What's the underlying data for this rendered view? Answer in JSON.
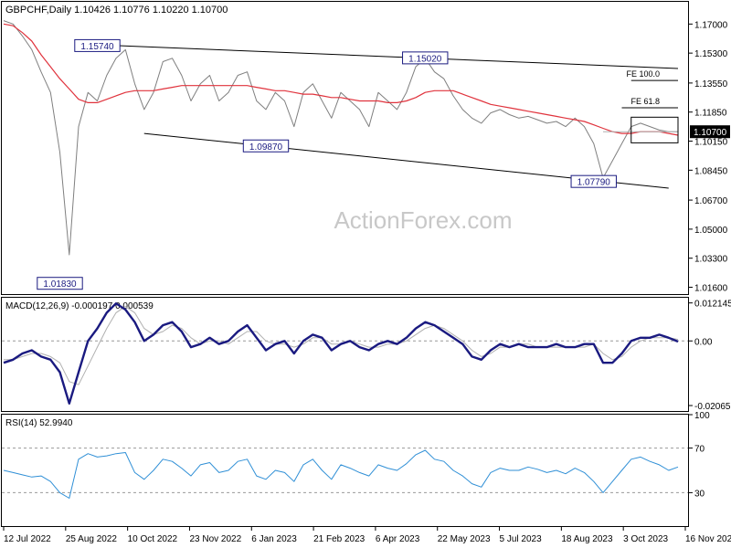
{
  "chart_data": [
    {
      "type": "line",
      "panel": "price",
      "header": "GBPCHF,Daily  1.10426 1.10776 1.10220 1.10700",
      "watermark": "ActionForex.com",
      "ylim": [
        1.012,
        1.183
      ],
      "y_ticks": [
        "1.17000",
        "1.15300",
        "1.13550",
        "1.11850",
        "1.10150",
        "1.08450",
        "1.06700",
        "1.05000",
        "1.03300",
        "1.01600"
      ],
      "current_price": "1.10700",
      "x_dates": [
        "2022-07-12",
        "2022-07-19",
        "2022-07-26",
        "2022-08-02",
        "2022-08-09",
        "2022-08-16",
        "2022-08-23",
        "2022-08-30",
        "2022-09-06",
        "2022-09-13",
        "2022-09-20",
        "2022-09-27",
        "2022-10-04",
        "2022-10-11",
        "2022-10-18",
        "2022-10-25",
        "2022-11-01",
        "2022-11-08",
        "2022-11-15",
        "2022-11-22",
        "2022-11-29",
        "2022-12-06",
        "2022-12-13",
        "2022-12-20",
        "2022-12-27",
        "2023-01-03",
        "2023-01-10",
        "2023-01-17",
        "2023-01-24",
        "2023-01-31",
        "2023-02-07",
        "2023-02-14",
        "2023-02-21",
        "2023-02-28",
        "2023-03-07",
        "2023-03-14",
        "2023-03-21",
        "2023-03-28",
        "2023-04-04",
        "2023-04-11",
        "2023-04-18",
        "2023-04-25",
        "2023-05-02",
        "2023-05-09",
        "2023-05-16",
        "2023-05-23",
        "2023-05-30",
        "2023-06-06",
        "2023-06-13",
        "2023-06-20",
        "2023-06-27",
        "2023-07-04",
        "2023-07-11",
        "2023-07-18",
        "2023-07-25",
        "2023-08-01",
        "2023-08-08",
        "2023-08-15",
        "2023-08-22",
        "2023-08-29",
        "2023-09-05",
        "2023-09-12",
        "2023-09-19",
        "2023-09-26",
        "2023-10-03",
        "2023-10-10",
        "2023-10-17",
        "2023-10-24",
        "2023-10-31",
        "2023-11-07",
        "2023-11-14",
        "2023-11-21",
        "2023-11-28"
      ],
      "series": [
        {
          "name": "",
          "color": "#7f7f7f",
          "values": [
            1.172,
            1.17,
            1.163,
            1.155,
            1.142,
            1.13,
            1.095,
            1.035,
            1.11,
            1.13,
            1.125,
            1.14,
            1.15,
            1.155,
            1.135,
            1.12,
            1.13,
            1.148,
            1.15,
            1.14,
            1.125,
            1.135,
            1.14,
            1.125,
            1.13,
            1.14,
            1.142,
            1.125,
            1.12,
            1.13,
            1.125,
            1.11,
            1.13,
            1.135,
            1.125,
            1.115,
            1.13,
            1.125,
            1.12,
            1.11,
            1.13,
            1.125,
            1.12,
            1.13,
            1.145,
            1.15,
            1.142,
            1.138,
            1.128,
            1.12,
            1.115,
            1.112,
            1.118,
            1.12,
            1.117,
            1.115,
            1.116,
            1.114,
            1.112,
            1.113,
            1.11,
            1.115,
            1.11,
            1.1,
            1.08,
            1.09,
            1.1,
            1.11,
            1.112,
            1.11,
            1.108,
            1.107,
            1.107
          ]
        },
        {
          "name": "",
          "color": "#e0333d",
          "values": [
            1.17,
            1.169,
            1.165,
            1.16,
            1.152,
            1.145,
            1.138,
            1.132,
            1.126,
            1.124,
            1.124,
            1.126,
            1.128,
            1.13,
            1.131,
            1.131,
            1.131,
            1.132,
            1.133,
            1.134,
            1.134,
            1.134,
            1.134,
            1.134,
            1.134,
            1.134,
            1.134,
            1.133,
            1.132,
            1.131,
            1.131,
            1.13,
            1.129,
            1.129,
            1.128,
            1.127,
            1.127,
            1.126,
            1.125,
            1.125,
            1.125,
            1.124,
            1.124,
            1.125,
            1.127,
            1.13,
            1.131,
            1.131,
            1.131,
            1.129,
            1.127,
            1.125,
            1.123,
            1.122,
            1.121,
            1.12,
            1.119,
            1.118,
            1.117,
            1.116,
            1.115,
            1.114,
            1.113,
            1.111,
            1.109,
            1.107,
            1.106,
            1.106,
            1.107,
            1.107,
            1.107,
            1.106,
            1.105
          ]
        }
      ],
      "trendlines": [
        {
          "from": [
            "2022-10-04",
            1.1574
          ],
          "to": [
            "2023-11-28",
            1.144
          ],
          "color": "#000000"
        },
        {
          "from": [
            "2022-10-25",
            1.106
          ],
          "to": [
            "2023-11-21",
            1.074
          ],
          "color": "#000000"
        },
        {
          "from": [
            "2023-10-03",
            1.107
          ],
          "to": [
            "2023-11-28",
            1.107
          ],
          "color": "#b0b0b0"
        }
      ],
      "levels": [
        {
          "label": "FE 100.0",
          "y": 1.137,
          "from": "2023-10-24",
          "to": "2023-11-28",
          "color": "#000000"
        },
        {
          "label": "FE 61.8",
          "y": 1.121,
          "from": "2023-10-17",
          "to": "2023-11-28",
          "color": "#000000"
        }
      ],
      "box": {
        "from": "2023-10-24",
        "to": "2023-11-28",
        "y_top": 1.1155,
        "y_bottom": 1.1005
      },
      "annotations": [
        {
          "label": "1.15740",
          "x": "2022-09-20",
          "y": 1.1574
        },
        {
          "label": "1.15020",
          "x": "2023-05-23",
          "y": 1.1502
        },
        {
          "label": "1.09870",
          "x": "2023-01-24",
          "y": 1.0987
        },
        {
          "label": "1.07790",
          "x": "2023-09-26",
          "y": 1.0779
        },
        {
          "label": "1.01830",
          "x": "2022-08-23",
          "y": 1.0183
        }
      ],
      "x_labels": [
        "12 Jul 2022",
        "25 Aug 2022",
        "10 Oct 2022",
        "23 Nov 2022",
        "6 Jan 2023",
        "21 Feb 2023",
        "6 Apr 2023",
        "22 May 2023",
        "5 Jul 2023",
        "18 Aug 2023",
        "3 Oct 2023",
        "16 Nov 2023"
      ]
    },
    {
      "type": "line",
      "panel": "macd",
      "header": "MACD(12,26,9) -0.000197 0.000539",
      "ylim": [
        -0.0224,
        0.0138
      ],
      "y_ticks": [
        "0.012145",
        "0.00",
        "-0.020656"
      ],
      "zero_line": 0,
      "series": [
        {
          "name": "",
          "color": "#1a1a80",
          "values": [
            -0.007,
            -0.006,
            -0.004,
            -0.003,
            -0.005,
            -0.006,
            -0.01,
            -0.02,
            -0.01,
            0.0,
            0.004,
            0.009,
            0.012,
            0.01,
            0.006,
            0.0,
            0.002,
            0.005,
            0.006,
            0.003,
            -0.002,
            -0.001,
            0.001,
            -0.001,
            0.0,
            0.003,
            0.005,
            0.001,
            -0.003,
            -0.001,
            0.0,
            -0.004,
            0.0,
            0.002,
            0.001,
            -0.003,
            -0.001,
            0.0,
            -0.002,
            -0.003,
            -0.001,
            0.0,
            -0.001,
            0.001,
            0.004,
            0.006,
            0.005,
            0.003,
            0.001,
            -0.001,
            -0.005,
            -0.006,
            -0.003,
            -0.001,
            -0.002,
            -0.001,
            -0.002,
            -0.002,
            -0.002,
            -0.001,
            -0.002,
            -0.002,
            -0.001,
            -0.001,
            -0.007,
            -0.007,
            -0.004,
            0.0,
            0.001,
            0.001,
            0.002,
            0.001,
            -0.0002
          ]
        },
        {
          "name": "",
          "color": "#b0b0b0",
          "values": [
            -0.006,
            -0.006,
            -0.005,
            -0.004,
            -0.004,
            -0.005,
            -0.007,
            -0.013,
            -0.014,
            -0.008,
            -0.002,
            0.004,
            0.009,
            0.011,
            0.009,
            0.004,
            0.002,
            0.003,
            0.005,
            0.004,
            0.001,
            -0.001,
            0.0,
            0.0,
            -0.001,
            0.001,
            0.003,
            0.003,
            0.0,
            -0.001,
            -0.001,
            -0.002,
            -0.001,
            0.001,
            0.001,
            -0.001,
            -0.001,
            0.0,
            -0.001,
            -0.002,
            -0.002,
            -0.001,
            -0.001,
            0.0,
            0.002,
            0.004,
            0.005,
            0.004,
            0.002,
            0.0,
            -0.003,
            -0.005,
            -0.004,
            -0.002,
            -0.002,
            -0.001,
            -0.001,
            -0.002,
            -0.002,
            -0.002,
            -0.002,
            -0.002,
            -0.002,
            -0.001,
            -0.004,
            -0.006,
            -0.005,
            -0.002,
            0.0,
            0.001,
            0.001,
            0.001,
            0.0005
          ]
        }
      ]
    },
    {
      "type": "line",
      "panel": "rsi",
      "header": "RSI(14) 52.9940",
      "ylim": [
        0,
        100
      ],
      "y_ticks": [
        "100",
        "70",
        "30",
        "0"
      ],
      "guide_lines": [
        70,
        30
      ],
      "series": [
        {
          "name": "",
          "color": "#2f8fd6",
          "values": [
            50,
            48,
            46,
            44,
            45,
            40,
            30,
            25,
            60,
            65,
            62,
            63,
            65,
            66,
            48,
            42,
            50,
            60,
            58,
            52,
            45,
            55,
            57,
            48,
            50,
            58,
            60,
            45,
            42,
            50,
            48,
            40,
            55,
            60,
            50,
            42,
            55,
            52,
            48,
            45,
            55,
            52,
            50,
            56,
            64,
            68,
            60,
            58,
            50,
            45,
            38,
            35,
            48,
            52,
            50,
            50,
            53,
            51,
            48,
            50,
            47,
            52,
            48,
            40,
            30,
            40,
            50,
            60,
            62,
            58,
            55,
            50,
            53
          ]
        }
      ]
    }
  ]
}
